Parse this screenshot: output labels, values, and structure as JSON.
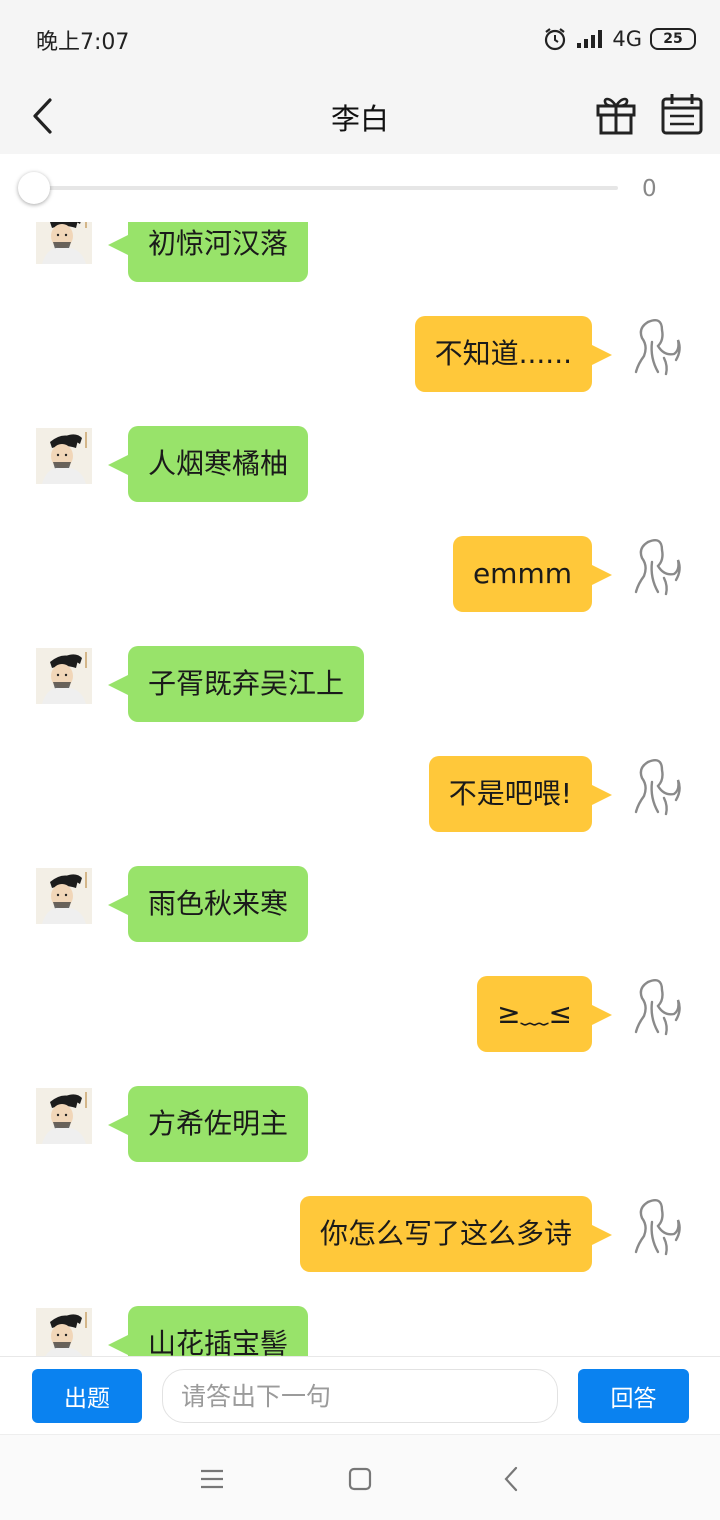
{
  "status_bar": {
    "time": "晚上7:07",
    "network": "4G",
    "battery": "25",
    "icons": [
      "alarm-icon",
      "signal-icon",
      "battery-icon"
    ]
  },
  "nav": {
    "title": "李白",
    "icons": [
      "back-arrow-icon",
      "gift-icon",
      "calendar-icon"
    ]
  },
  "progress": {
    "value_label": "0",
    "fraction": 0,
    "accent_color": "#3b8ef5"
  },
  "messages": [
    {
      "side": "left",
      "text": "初惊河汉落"
    },
    {
      "side": "right",
      "text": "不知道......"
    },
    {
      "side": "left",
      "text": "人烟寒橘柚"
    },
    {
      "side": "right",
      "text": "emmm"
    },
    {
      "side": "left",
      "text": "子胥既弃吴江上"
    },
    {
      "side": "right",
      "text": "不是吧喂!"
    },
    {
      "side": "left",
      "text": "雨色秋来寒"
    },
    {
      "side": "right",
      "text": "≥﹏≤"
    },
    {
      "side": "left",
      "text": "方希佐明主"
    },
    {
      "side": "right",
      "text": "你怎么写了这么多诗"
    },
    {
      "side": "left",
      "text": "山花插宝髻"
    }
  ],
  "input_bar": {
    "question_button": "出题",
    "placeholder": "请答出下一句",
    "value": "",
    "answer_button": "回答"
  },
  "colors": {
    "left_bubble": "#98e36a",
    "right_bubble": "#ffc83a",
    "button_blue": "#0a82f0"
  },
  "system_nav": {
    "icons": [
      "menu-icon",
      "home-icon",
      "back-icon"
    ]
  }
}
